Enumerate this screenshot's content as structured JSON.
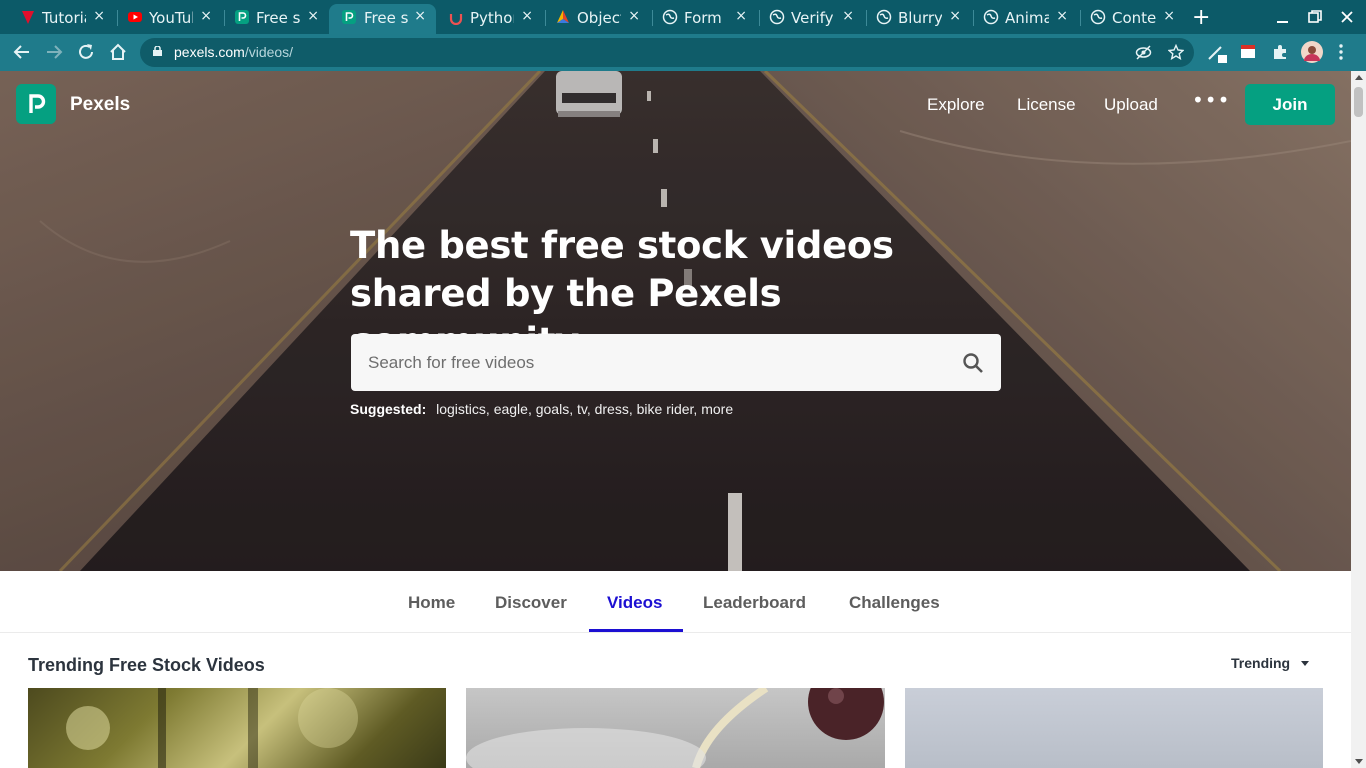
{
  "browser": {
    "tabs": [
      {
        "title": "Tutorial",
        "icon": "vivaldi-red-icon"
      },
      {
        "title": "YouTube",
        "icon": "youtube-icon"
      },
      {
        "title": "Free s",
        "icon": "pexels-icon"
      },
      {
        "title": "Free s",
        "icon": "pexels-icon",
        "active": true
      },
      {
        "title": "Python",
        "icon": "udemy-icon"
      },
      {
        "title": "Object",
        "icon": "stack-icon"
      },
      {
        "title": "Form",
        "icon": "globe-icon"
      },
      {
        "title": "Verify",
        "icon": "globe-icon"
      },
      {
        "title": "Blurry",
        "icon": "globe-icon"
      },
      {
        "title": "Anima",
        "icon": "globe-icon"
      },
      {
        "title": "Conte",
        "icon": "globe-icon"
      }
    ],
    "close_glyph": "×",
    "new_tab_glyph": "+",
    "url": {
      "host": "pexels.com",
      "path": "/videos/"
    },
    "colors": {
      "tabbar": "#0c5a68",
      "toolbar": "#1f7b8b"
    }
  },
  "header": {
    "logo_letter": "P",
    "logo_text": "Pexels",
    "nav": [
      "Explore",
      "License",
      "Upload"
    ],
    "more_glyph": "•••",
    "join_label": "Join",
    "brand_color": "#05a081"
  },
  "hero": {
    "title": "The best free stock videos shared by the Pexels community.",
    "search_placeholder": "Search for free videos",
    "suggested_label": "Suggested:",
    "suggested": "logistics, eagle, goals, tv, dress, bike rider, more"
  },
  "subnav": {
    "items": [
      "Home",
      "Discover",
      "Videos",
      "Leaderboard",
      "Challenges"
    ],
    "active": "Videos",
    "active_color": "#1c0fd2"
  },
  "content": {
    "section_title": "Trending Free Stock Videos",
    "sort_label": "Trending"
  }
}
